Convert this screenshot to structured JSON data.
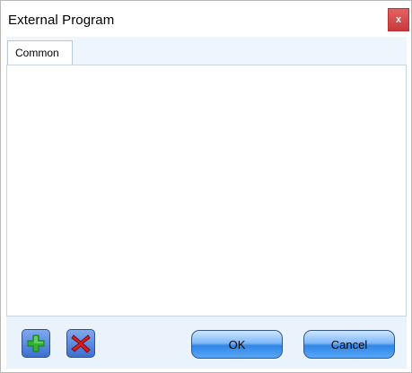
{
  "window": {
    "title": "External Program",
    "close_label": "x"
  },
  "tabs": [
    {
      "label": "Common",
      "selected": true
    }
  ],
  "footer": {
    "add_icon": "plus-icon",
    "remove_icon": "red-x-icon",
    "ok_label": "OK",
    "cancel_label": "Cancel"
  },
  "colors": {
    "accent": "#2f86e8",
    "close": "#d94a4a",
    "add": "#2fb32f",
    "remove": "#d81e1e"
  }
}
